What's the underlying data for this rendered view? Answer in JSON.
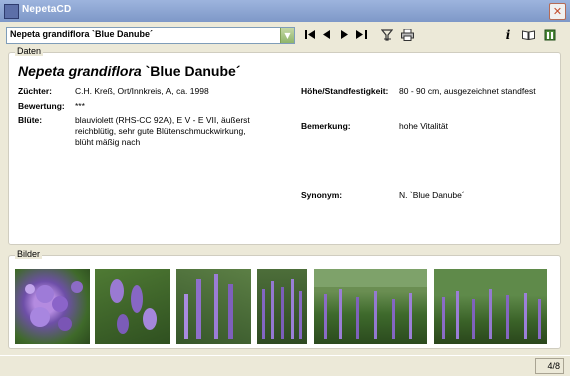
{
  "window": {
    "title": "NepetaCD"
  },
  "toolbar": {
    "selected_plant": "Nepeta grandiflora `Blue Danube´",
    "icons": [
      "first-icon",
      "prev-icon",
      "next-icon",
      "last-icon",
      "filter-icon",
      "print-icon",
      "info-icon",
      "book-icon",
      "plant-icon"
    ]
  },
  "data_panel": {
    "legend": "Daten",
    "title_genus": "Nepeta grandiflora",
    "title_cultivar": "`Blue Danube´",
    "left": {
      "zuechter_label": "Züchter:",
      "zuechter_value": "C.H. Kreß, Ort/Innkreis, A, ca. 1998",
      "bewertung_label": "Bewertung:",
      "bewertung_value": "***",
      "bluete_label": "Blüte:",
      "bluete_value_1": "blauviolett (RHS-CC 92A), E V - E VII, äußerst",
      "bluete_value_2": "reichblütig, sehr gute Blütenschmuckwirkung,",
      "bluete_value_3": "blüht mäßig nach"
    },
    "right": {
      "hoehe_label": "Höhe/Standfestigkeit:",
      "hoehe_value": "80 - 90 cm, ausgezeichnet standfest",
      "bemerkung_label": "Bemerkung:",
      "bemerkung_value": "hohe Vitalität",
      "synonym_label": "Synonym:",
      "synonym_value": "N. `Blue Danube´"
    }
  },
  "images_panel": {
    "legend": "Bilder"
  },
  "status": {
    "page": "4/8"
  },
  "colors": {
    "accent": "#7E98C8",
    "close": "#C24A2A",
    "combo_button": "#8FB56B"
  }
}
